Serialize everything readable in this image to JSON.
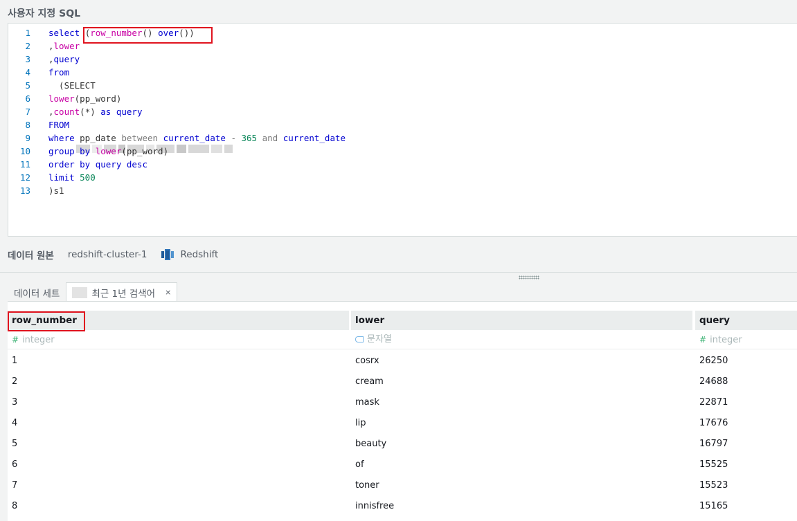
{
  "section_title": "사용자 지정 SQL",
  "editor": {
    "lines": [
      {
        "n": "1",
        "tokens": [
          [
            "kw",
            "select "
          ],
          [
            "id",
            "("
          ],
          [
            "fn",
            "row_number"
          ],
          [
            "id",
            "() "
          ],
          [
            "kw",
            "over"
          ],
          [
            "id",
            "())"
          ]
        ]
      },
      {
        "n": "2",
        "tokens": [
          [
            "id",
            ","
          ],
          [
            "fn",
            "lower"
          ]
        ]
      },
      {
        "n": "3",
        "tokens": [
          [
            "id",
            ","
          ],
          [
            "kw",
            "query"
          ]
        ]
      },
      {
        "n": "4",
        "tokens": [
          [
            "kw",
            "from"
          ]
        ]
      },
      {
        "n": "5",
        "tokens": [
          [
            "id",
            "  (SELECT"
          ]
        ]
      },
      {
        "n": "6",
        "tokens": [
          [
            "fn",
            "lower"
          ],
          [
            "id",
            "(pp_word)"
          ]
        ]
      },
      {
        "n": "7",
        "tokens": [
          [
            "id",
            ","
          ],
          [
            "fn",
            "count"
          ],
          [
            "id",
            "(*) "
          ],
          [
            "kw",
            "as query"
          ]
        ]
      },
      {
        "n": "8",
        "tokens": [
          [
            "kw",
            "FROM"
          ]
        ]
      },
      {
        "n": "9",
        "tokens": [
          [
            "kw",
            "where "
          ],
          [
            "id",
            "pp_date "
          ],
          [
            "op",
            "between "
          ],
          [
            "kw",
            "current_date "
          ],
          [
            "op",
            "- "
          ],
          [
            "num",
            "365 "
          ],
          [
            "op",
            "and "
          ],
          [
            "kw",
            "current_date"
          ]
        ]
      },
      {
        "n": "10",
        "tokens": [
          [
            "kw",
            "group by "
          ],
          [
            "fn",
            "lower"
          ],
          [
            "id",
            "(pp_word)"
          ]
        ]
      },
      {
        "n": "11",
        "tokens": [
          [
            "kw",
            "order by query desc"
          ]
        ]
      },
      {
        "n": "12",
        "tokens": [
          [
            "kw",
            "limit "
          ],
          [
            "num",
            "500"
          ]
        ]
      },
      {
        "n": "13",
        "tokens": [
          [
            "id",
            ")s1"
          ]
        ]
      }
    ]
  },
  "datasource": {
    "label": "데이터 원본",
    "cluster": "redshift-cluster-1",
    "engine": "Redshift",
    "icon": "redshift-icon"
  },
  "tabs": [
    {
      "label": "데이터 세트"
    },
    {
      "label": "최근 1년 검색어",
      "close": "×"
    }
  ],
  "grid": {
    "columns": [
      {
        "name": "row_number",
        "type": "integer",
        "icon": "#"
      },
      {
        "name": "lower",
        "type": "문자열",
        "icon": "string-icon"
      },
      {
        "name": "query",
        "type": "integer",
        "icon": "#"
      }
    ],
    "rows": [
      [
        "1",
        "cosrx",
        "26250"
      ],
      [
        "2",
        "cream",
        "24688"
      ],
      [
        "3",
        "mask",
        "22871"
      ],
      [
        "4",
        "lip",
        "17676"
      ],
      [
        "5",
        "beauty",
        "16797"
      ],
      [
        "6",
        "of",
        "15525"
      ],
      [
        "7",
        "toner",
        "15523"
      ],
      [
        "8",
        "innisfree",
        "15165"
      ]
    ]
  }
}
